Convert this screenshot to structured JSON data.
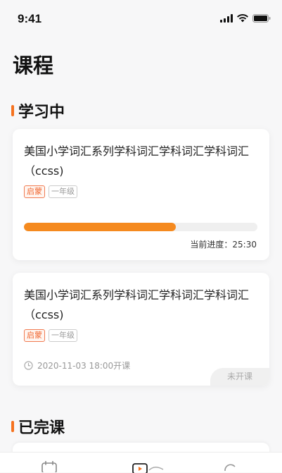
{
  "status_bar": {
    "time": "9:41"
  },
  "page": {
    "title": "课程"
  },
  "sections": {
    "learning": "学习中",
    "completed": "已完课"
  },
  "courses": [
    {
      "title": "美国小学词汇系列学科词汇学科词汇学科词汇（ccss)",
      "tags": [
        "启蒙",
        "一年级"
      ],
      "progress_fraction": 0.65,
      "progress_label": "当前进度：25:30"
    },
    {
      "title": "美国小学词汇系列学科词汇学科词汇学科词汇（ccss)",
      "tags": [
        "启蒙",
        "一年级"
      ],
      "schedule": "2020-11-03 18:00开课",
      "status": "未开课"
    }
  ],
  "colors": {
    "accent": "#f5721f",
    "progress": "#f58a1f",
    "tag_primary": "#f06a35"
  },
  "icons": {
    "signal": "signal-icon",
    "wifi": "wifi-icon",
    "battery": "battery-icon",
    "clock": "clock-icon",
    "tab_calendar": "calendar-icon",
    "tab_course": "course-icon",
    "tab_refresh": "refresh-icon"
  }
}
